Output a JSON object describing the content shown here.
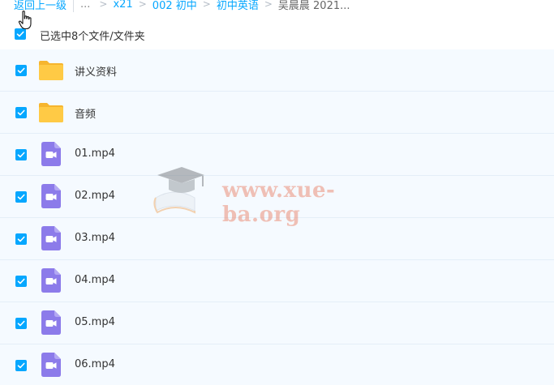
{
  "breadcrumb": {
    "back_label": "返回上一级",
    "ellipsis": "...",
    "separator": ">",
    "items": [
      "x21",
      "002 初中",
      "初中英语"
    ],
    "current": "吴晨晨 2021..."
  },
  "selection": {
    "label": "已选中8个文件/文件夹",
    "checked": true
  },
  "files": [
    {
      "name": "讲义资料",
      "type": "folder",
      "checked": true
    },
    {
      "name": "音频",
      "type": "folder",
      "checked": true
    },
    {
      "name": "01.mp4",
      "type": "video",
      "checked": true
    },
    {
      "name": "02.mp4",
      "type": "video",
      "checked": true
    },
    {
      "name": "03.mp4",
      "type": "video",
      "checked": true
    },
    {
      "name": "04.mp4",
      "type": "video",
      "checked": true
    },
    {
      "name": "05.mp4",
      "type": "video",
      "checked": true
    },
    {
      "name": "06.mp4",
      "type": "video",
      "checked": true
    }
  ],
  "watermark": {
    "text": "www.xue-ba.org"
  },
  "colors": {
    "accent": "#06a7ff",
    "row_bg": "#f5faff",
    "folder": "#ffc93f",
    "video": "#8c7bea"
  }
}
